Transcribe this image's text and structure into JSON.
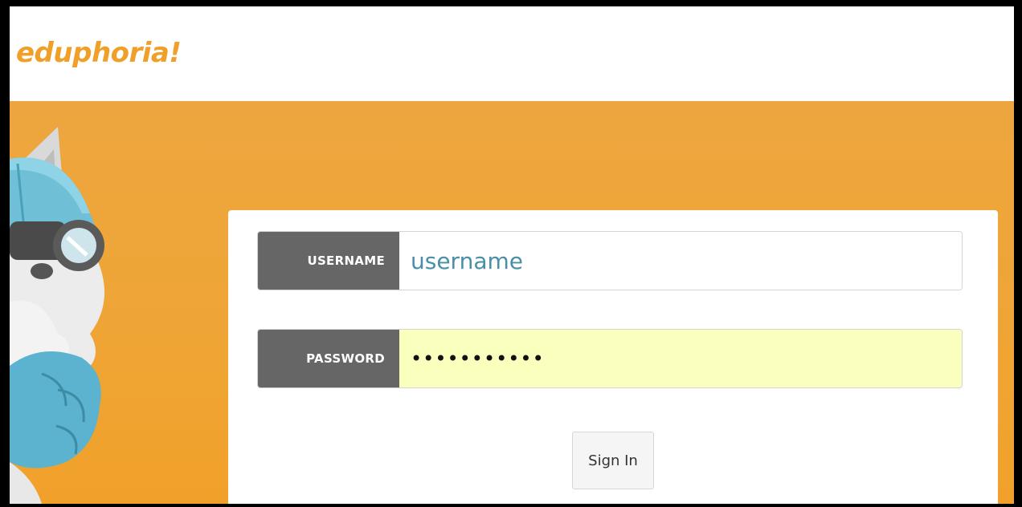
{
  "brand": {
    "logo_text": "eduphoria!"
  },
  "login": {
    "username_label": "USERNAME",
    "username_value": "username",
    "password_label": "PASSWORD",
    "password_value": "•••••••••••",
    "signin_label": "Sign In"
  },
  "colors": {
    "brand_orange": "#F0A028",
    "hero_background": "#EFA536",
    "label_bg": "#666666",
    "autofill_yellow": "#FAFFBD"
  },
  "mascot": {
    "icon": "fox-mascot-with-goggles-icon"
  }
}
